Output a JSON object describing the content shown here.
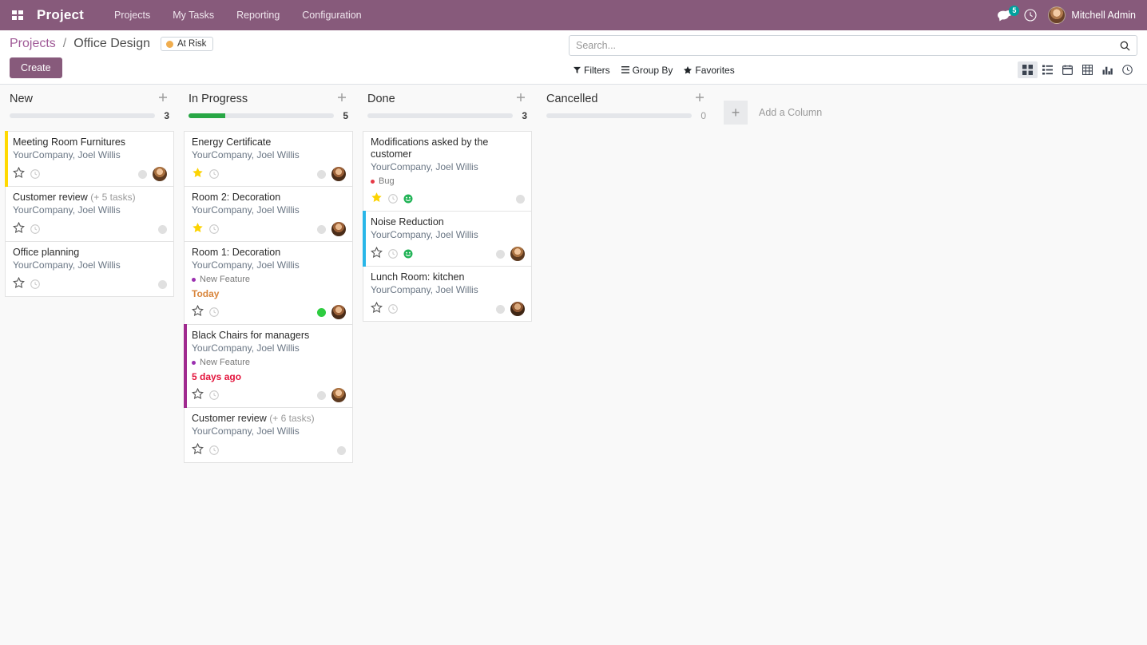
{
  "navbar": {
    "apps_icon": "apps-grid-icon",
    "brand": "Project",
    "menu": [
      {
        "label": "Projects"
      },
      {
        "label": "My Tasks"
      },
      {
        "label": "Reporting"
      },
      {
        "label": "Configuration"
      }
    ],
    "messages_icon": "chat-bubbles-icon",
    "messages_count": "5",
    "activity_icon": "clock-icon",
    "avatar_icon": "user-avatar",
    "user_name": "Mitchell Admin",
    "accent_color": "#875A7B",
    "badge_color": "#00A09D"
  },
  "control_panel": {
    "breadcrumb_root": "Projects",
    "breadcrumb_sep": "/",
    "breadcrumb_current": "Office Design",
    "risk_badge": "At Risk",
    "risk_color": "#f0ad4e",
    "create_label": "Create",
    "search": {
      "value": "",
      "placeholder": "Search...",
      "icon": "search-icon"
    },
    "filters_label": "Filters",
    "group_by_label": "Group By",
    "favorites_label": "Favorites",
    "views": [
      {
        "name": "kanban",
        "icon": "kanban-icon",
        "active": true
      },
      {
        "name": "list",
        "icon": "list-icon",
        "active": false
      },
      {
        "name": "calendar",
        "icon": "calendar-icon",
        "active": false
      },
      {
        "name": "pivot",
        "icon": "pivot-table-icon",
        "active": false
      },
      {
        "name": "graph",
        "icon": "bar-chart-icon",
        "active": false
      },
      {
        "name": "activity",
        "icon": "activity-clock-icon",
        "active": false
      }
    ]
  },
  "kanban": {
    "add_column_label": "Add a Column",
    "add_column_icon": "plus-icon",
    "columns": [
      {
        "title": "New",
        "count": "3",
        "progress_pct": 0,
        "cards": [
          {
            "title": "Meeting Room Furnitures",
            "extra": "",
            "subtitle": "YourCompany, Joel Willis",
            "tag": null,
            "date": null,
            "starred": false,
            "stripe": "#ffd900",
            "smiley": false,
            "status": "grey",
            "avatar": "a1"
          },
          {
            "title": "Customer review",
            "extra": "(+ 5 tasks)",
            "subtitle": "YourCompany, Joel Willis",
            "tag": null,
            "date": null,
            "starred": false,
            "stripe": null,
            "smiley": false,
            "status": "grey",
            "avatar": null
          },
          {
            "title": "Office planning",
            "extra": "",
            "subtitle": "YourCompany, Joel Willis",
            "tag": null,
            "date": null,
            "starred": false,
            "stripe": null,
            "smiley": false,
            "status": "grey",
            "avatar": null
          }
        ]
      },
      {
        "title": "In Progress",
        "count": "5",
        "progress_pct": 25,
        "cards": [
          {
            "title": "Energy Certificate",
            "extra": "",
            "subtitle": "YourCompany, Joel Willis",
            "tag": null,
            "date": null,
            "starred": true,
            "stripe": null,
            "smiley": false,
            "status": "grey",
            "avatar": "a2"
          },
          {
            "title": "Room 2: Decoration",
            "extra": "",
            "subtitle": "YourCompany, Joel Willis",
            "tag": null,
            "date": null,
            "starred": true,
            "stripe": null,
            "smiley": false,
            "status": "grey",
            "avatar": "a2"
          },
          {
            "title": "Room 1: Decoration",
            "extra": "",
            "subtitle": "YourCompany, Joel Willis",
            "tag": {
              "label": "New Feature",
              "color": "#9b30b0"
            },
            "date": {
              "text": "Today",
              "color": "#d9863c"
            },
            "starred": false,
            "stripe": null,
            "smiley": false,
            "status": "green",
            "avatar": "a2"
          },
          {
            "title": "Black Chairs for managers",
            "extra": "",
            "subtitle": "YourCompany, Joel Willis",
            "tag": {
              "label": "New Feature",
              "color": "#9b30b0"
            },
            "date": {
              "text": "5 days ago",
              "color": "#e3143c"
            },
            "starred": false,
            "stripe": "#a02a8f",
            "smiley": false,
            "status": "grey",
            "avatar": "a1"
          },
          {
            "title": "Customer review",
            "extra": "(+ 6 tasks)",
            "subtitle": "YourCompany, Joel Willis",
            "tag": null,
            "date": null,
            "starred": false,
            "stripe": null,
            "smiley": false,
            "status": "grey",
            "avatar": null
          }
        ]
      },
      {
        "title": "Done",
        "count": "3",
        "progress_pct": 0,
        "cards": [
          {
            "title": "Modifications asked by the customer",
            "extra": "",
            "subtitle": "YourCompany, Joel Willis",
            "tag": {
              "label": "Bug",
              "color": "#e63946"
            },
            "date": null,
            "starred": true,
            "stripe": null,
            "smiley": true,
            "status": "grey",
            "avatar": null
          },
          {
            "title": "Noise Reduction",
            "extra": "",
            "subtitle": "YourCompany, Joel Willis",
            "tag": null,
            "date": null,
            "starred": false,
            "stripe": "#29b6e8",
            "smiley": true,
            "status": "grey",
            "avatar": "a1"
          },
          {
            "title": "Lunch Room: kitchen",
            "extra": "",
            "subtitle": "YourCompany, Joel Willis",
            "tag": null,
            "date": null,
            "starred": false,
            "stripe": null,
            "smiley": false,
            "status": "grey",
            "avatar": "a3"
          }
        ]
      },
      {
        "title": "Cancelled",
        "count": "0",
        "progress_pct": 0,
        "cards": []
      }
    ]
  }
}
